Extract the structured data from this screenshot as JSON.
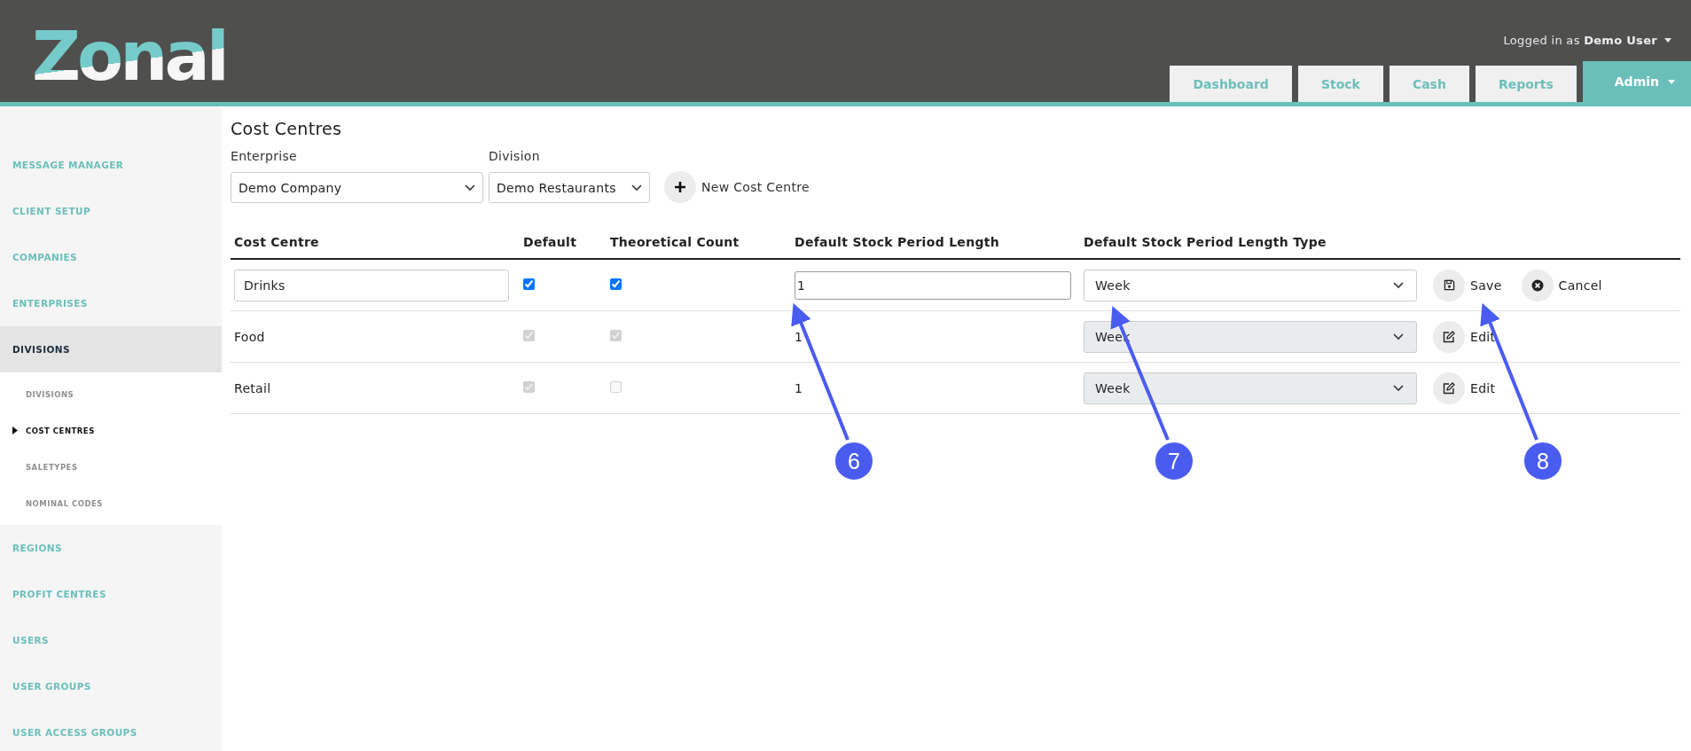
{
  "header": {
    "logo": "Zonal",
    "user_prefix": "Logged in as",
    "user_name": "Demo User",
    "tabs": [
      {
        "label": "Dashboard",
        "selected": false,
        "dropdown": false
      },
      {
        "label": "Stock",
        "selected": false,
        "dropdown": false
      },
      {
        "label": "Cash",
        "selected": false,
        "dropdown": false
      },
      {
        "label": "Reports",
        "selected": false,
        "dropdown": false
      },
      {
        "label": "Admin",
        "selected": true,
        "dropdown": true
      }
    ]
  },
  "sidebar": {
    "items": [
      {
        "label": "MESSAGE MANAGER",
        "selected": false
      },
      {
        "label": "CLIENT SETUP",
        "selected": false
      },
      {
        "label": "COMPANIES",
        "selected": false
      },
      {
        "label": "ENTERPRISES",
        "selected": false
      },
      {
        "label": "DIVISIONS",
        "selected": true,
        "expanded": true,
        "children": [
          {
            "label": "DIVISIONS",
            "selected": false
          },
          {
            "label": "COST CENTRES",
            "selected": true
          },
          {
            "label": "SALETYPES",
            "selected": false
          },
          {
            "label": "NOMINAL CODES",
            "selected": false
          }
        ]
      },
      {
        "label": "REGIONS",
        "selected": false
      },
      {
        "label": "PROFIT CENTRES",
        "selected": false
      },
      {
        "label": "USERS",
        "selected": false
      },
      {
        "label": "USER GROUPS",
        "selected": false
      },
      {
        "label": "USER ACCESS GROUPS",
        "selected": false
      }
    ]
  },
  "page": {
    "title": "Cost Centres",
    "filters": [
      {
        "label": "Enterprise",
        "value": "Demo Company"
      },
      {
        "label": "Division",
        "value": "Demo Restaurants"
      }
    ],
    "new_button": "New Cost Centre"
  },
  "table": {
    "columns": [
      "Cost Centre",
      "Default",
      "Theoretical Count",
      "Default Stock Period Length",
      "Default Stock Period Length Type"
    ],
    "rows": [
      {
        "kind": "edit",
        "name": "Drinks",
        "default": true,
        "theoretical_count": true,
        "length": "1",
        "type": "Week",
        "actions": [
          "Save",
          "Cancel"
        ]
      },
      {
        "kind": "view",
        "name": "Food",
        "default": true,
        "theoretical_count": true,
        "length": "1",
        "type": "Week",
        "actions": [
          "Edit"
        ]
      },
      {
        "kind": "view",
        "name": "Retail",
        "default": true,
        "theoretical_count": false,
        "length": "1",
        "type": "Week",
        "actions": [
          "Edit"
        ]
      }
    ]
  },
  "callouts": [
    {
      "number": "6"
    },
    {
      "number": "7"
    },
    {
      "number": "8"
    }
  ]
}
